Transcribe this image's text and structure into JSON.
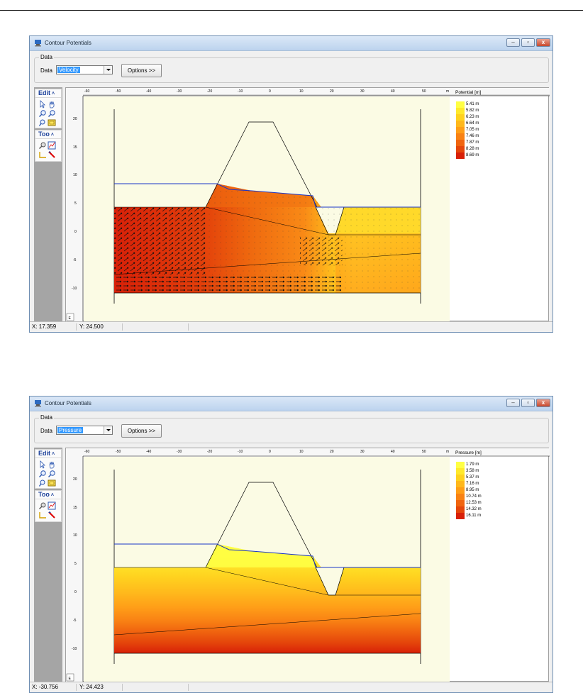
{
  "windows": [
    {
      "title": "Contour Potentials",
      "group_label": "Data",
      "data_label": "Data",
      "selected": "Velocity",
      "options_label": "Options >>",
      "tool_headers": [
        "Edit",
        "Too"
      ],
      "legend": {
        "title": "Potential [m]",
        "items": [
          "5.41 m",
          "5.82 m",
          "6.23 m",
          "6.64 m",
          "7.05 m",
          "7.46 m",
          "7.87 m",
          "8.28 m",
          "8.69 m"
        ]
      },
      "status": {
        "x": "X: 17.359",
        "y": "Y: 24.500"
      },
      "top_ticks": [
        "-60",
        "-50",
        "-40",
        "-30",
        "-20",
        "-10",
        "0",
        "10",
        "20",
        "30",
        "40",
        "50",
        "m"
      ],
      "left_ticks": [
        "20",
        "15",
        "10",
        "5",
        "0",
        "-5",
        "-10"
      ],
      "corner_label": "E"
    },
    {
      "title": "Contour Potentials",
      "group_label": "Data",
      "data_label": "Data",
      "selected": "Pressure",
      "options_label": "Options >>",
      "tool_headers": [
        "Edit",
        "Too"
      ],
      "legend": {
        "title": "Pressure [m]",
        "items": [
          "1.79 m",
          "3.58 m",
          "5.37 m",
          "7.16 m",
          "8.95 m",
          "10.74 m",
          "12.53 m",
          "14.32 m",
          "16.11 m"
        ]
      },
      "status": {
        "x": "X: -30.756",
        "y": "Y: 24.423"
      },
      "top_ticks": [
        "-60",
        "-50",
        "-40",
        "-30",
        "-20",
        "-10",
        "0",
        "10",
        "20",
        "30",
        "40",
        "50",
        "m"
      ],
      "left_ticks": [
        "20",
        "15",
        "10",
        "5",
        "0",
        "-5",
        "-10"
      ],
      "corner_label": "E"
    }
  ],
  "colors": {
    "legend": [
      "#ffff44",
      "#ffe92c",
      "#ffd21f",
      "#ffb81c",
      "#ff9e18",
      "#f98214",
      "#f0640f",
      "#e5460b",
      "#d82008"
    ],
    "plot_bg": "#fbfbe4",
    "phreatic_line": "#1a35c8",
    "titlebar": "#c8daf0"
  }
}
